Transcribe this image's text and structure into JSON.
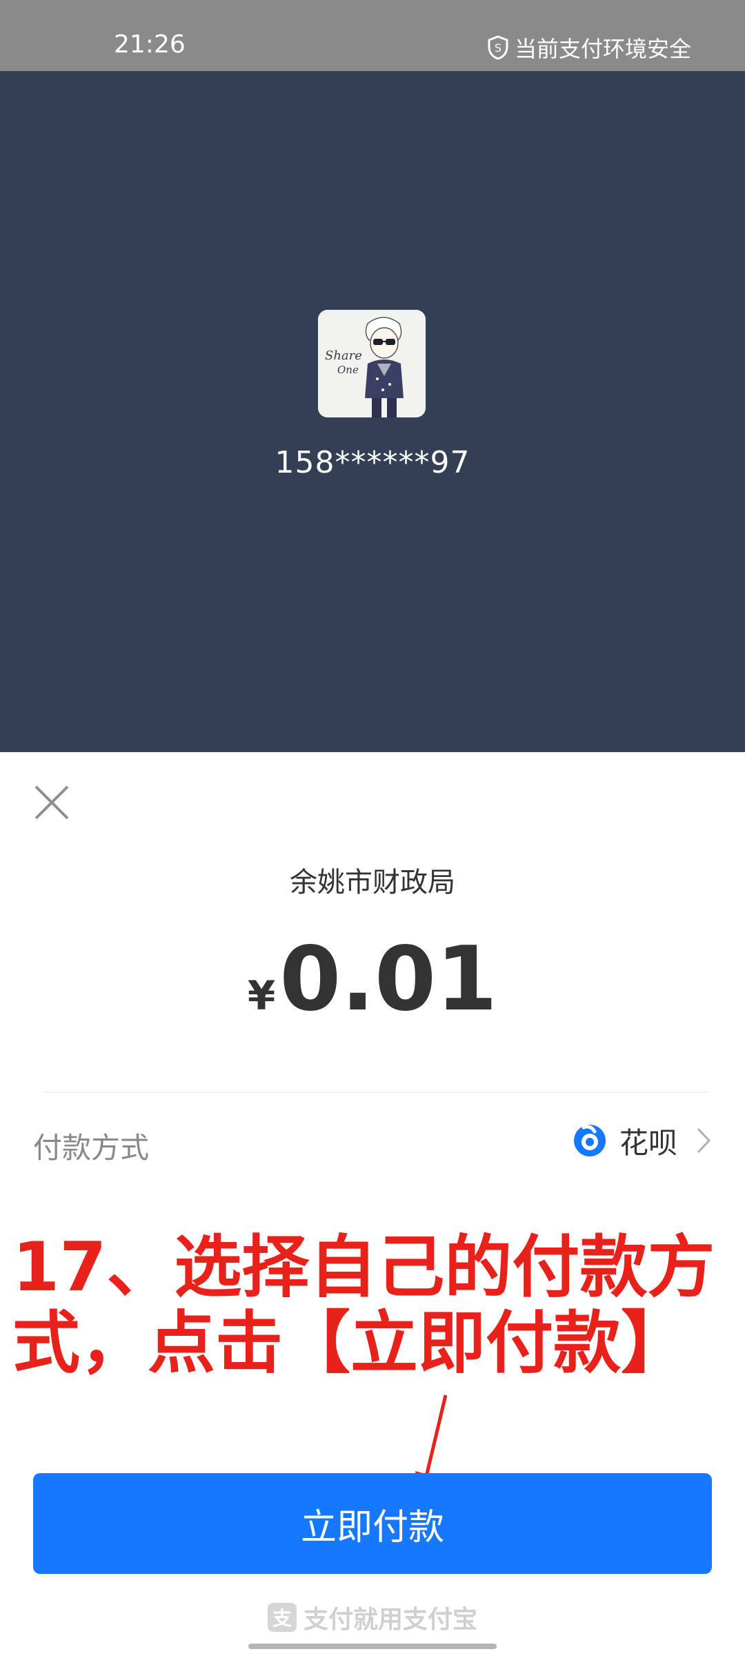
{
  "status_bar": {
    "time": "21:26",
    "security_text": "当前支付环境安全",
    "security_icon": "shield-icon"
  },
  "payee": {
    "avatar_text_line1": "Share",
    "avatar_text_line2": "One",
    "account": "158******97"
  },
  "sheet": {
    "close_icon": "close-icon",
    "merchant_name": "余姚市财政局",
    "currency_symbol": "¥",
    "amount": "0.01",
    "payment_method_label": "付款方式",
    "payment_method_value": "花呗",
    "payment_method_icon": "huabei-icon",
    "pay_button_label": "立即付款",
    "footer_text": "支付就用支付宝",
    "footer_logo": "支"
  },
  "annotation": {
    "line1": "17、选择自己的付款方",
    "line2": "式，点击【立即付款】"
  },
  "colors": {
    "dark_panel": "#333f55",
    "primary_blue": "#1677ff",
    "annotation_red": "#e8211a"
  }
}
